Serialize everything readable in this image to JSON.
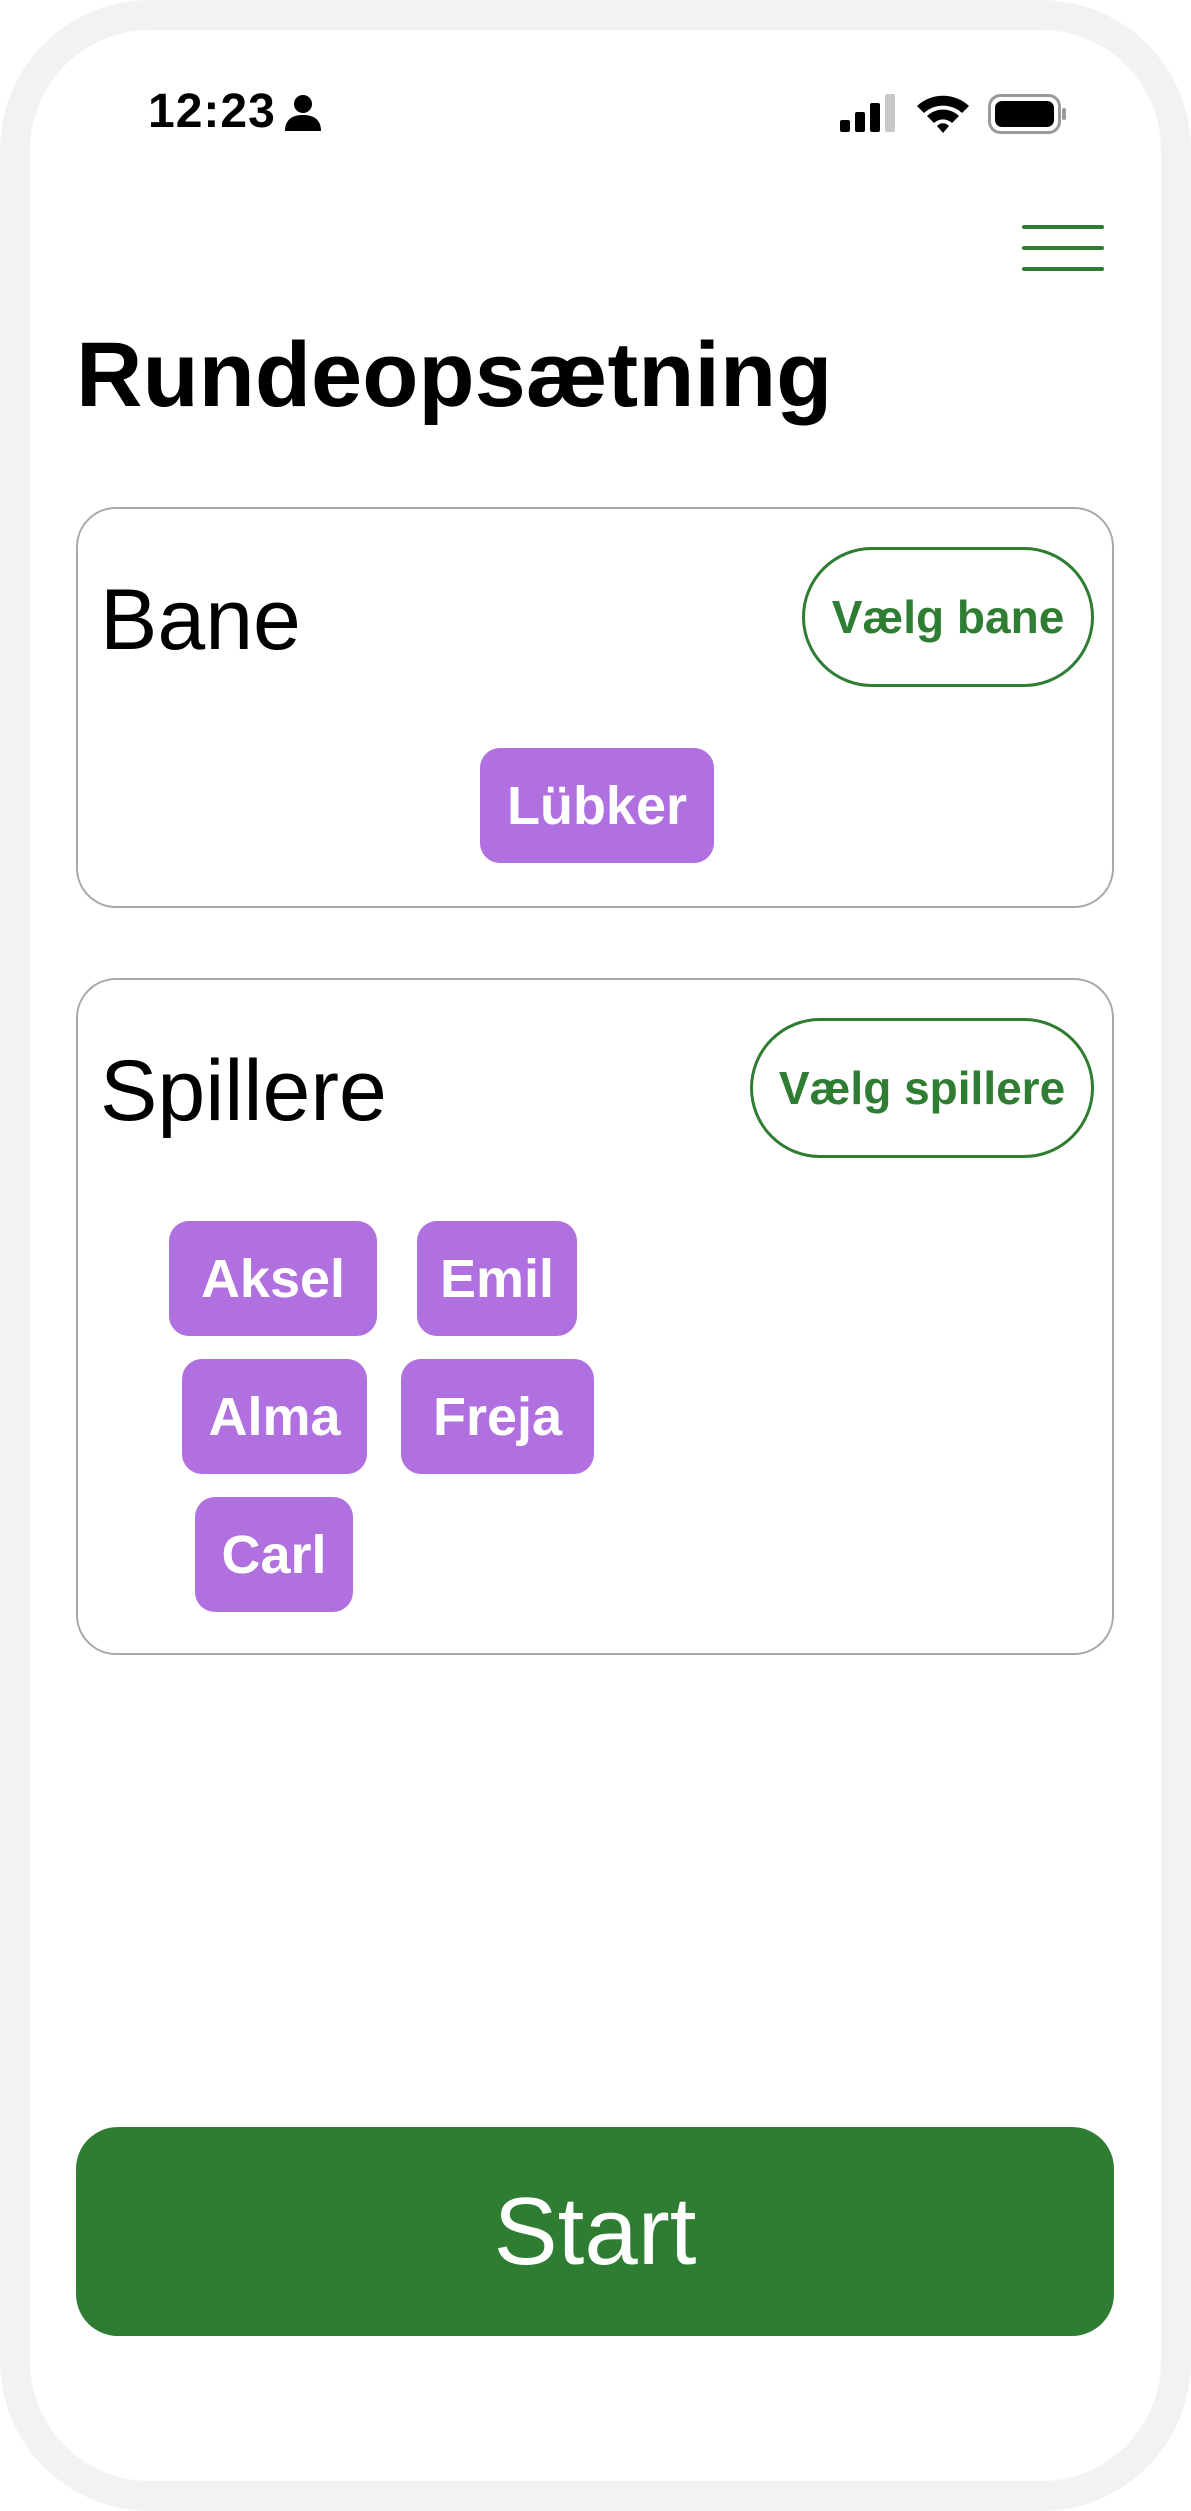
{
  "status_bar": {
    "time": "12:23",
    "icons": [
      "person-icon",
      "signal-icon",
      "wifi-icon",
      "battery-icon"
    ]
  },
  "header": {
    "menu_icon": "hamburger-menu-icon",
    "title": "Rundeopsætning"
  },
  "course_section": {
    "title": "Bane",
    "choose_button": "Vælg bane",
    "selected_course": "Lübker"
  },
  "players_section": {
    "title": "Spillere",
    "choose_button": "Vælg spillere",
    "players": [
      "Aksel",
      "Emil",
      "Alma",
      "Freja",
      "Carl"
    ]
  },
  "footer": {
    "start_button": "Start"
  },
  "colors": {
    "accent_green": "#2e7d32",
    "chip_purple": "#b070e0",
    "card_border": "#a8a8a8",
    "frame": "#f2f2f2"
  }
}
